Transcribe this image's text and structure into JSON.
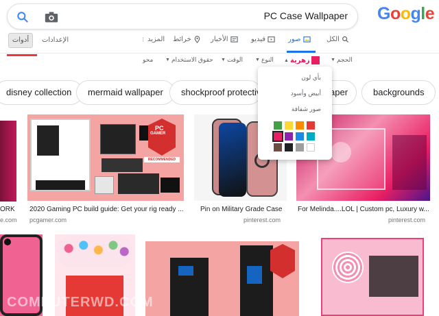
{
  "search": {
    "query": "PC Case Wallpaper"
  },
  "logo": "Google",
  "tabs": {
    "all": "الكل",
    "images": "صور",
    "videos": "فيديو",
    "news": "الأخبار",
    "maps": "خرائط",
    "more": "المزيد",
    "settings": "الإعدادات",
    "tools": "أدوات"
  },
  "filters": {
    "size": "الحجم",
    "color": "زهرية",
    "type": "النوع",
    "time": "الوقت",
    "rights": "حقوق الاستخدام",
    "clear": "محو"
  },
  "color_menu": {
    "any": "بأي لون",
    "bw": "أبيض وأسود",
    "transparent": "صور شفافة",
    "swatches": [
      "#43a047",
      "#fdd835",
      "#fb8c00",
      "#e53935",
      "#e91e63",
      "#8e24aa",
      "#1e88e5",
      "#00acc1",
      "#6d4c41",
      "#202124",
      "#9e9e9e",
      "#ffffff"
    ],
    "selected_index": 4
  },
  "chips": [
    "disney collection",
    "mermaid wallpaper",
    "shockproof protective",
    "aper",
    "backgrounds"
  ],
  "results": [
    {
      "caption": "ORK",
      "source": "e.com"
    },
    {
      "caption": "2020 Gaming PC build guide: Get your rig ready ...",
      "source": "pcgamer.com"
    },
    {
      "caption": "Pin on Military Grade Case",
      "source": "pinterest.com"
    },
    {
      "caption": "For Melinda....LOL | Custom pc, Luxury w...",
      "source": "pinterest.com"
    }
  ],
  "badges": {
    "pc": "PC",
    "gamer": "GAMER",
    "recommended": "RECOMMENDED"
  },
  "watermark": "COMPUTERWD.COM"
}
